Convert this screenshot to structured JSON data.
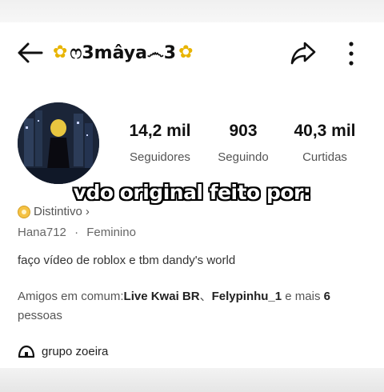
{
  "header": {
    "title": "ෆ3mâya෴3",
    "flower_glyph": "✿",
    "back_icon": "arrow-left-icon",
    "share_icon": "share-icon",
    "more_icon": "more-vertical-icon"
  },
  "stats": [
    {
      "value": "14,2 mil",
      "label": "Seguidores"
    },
    {
      "value": "903",
      "label": "Seguindo"
    },
    {
      "value": "40,3 mil",
      "label": "Curtidas"
    }
  ],
  "overlay_caption": "vdo original feito por:",
  "badge": {
    "label": "Distintivo",
    "chevron": "›"
  },
  "user_meta": {
    "username": "Hana712",
    "separator": "·",
    "gender": "Feminino"
  },
  "bio": "faço vídeo de roblox e tbm dandy's world",
  "mutual": {
    "prefix": "Amigos em comum:",
    "friend1": "Live Kwai BR",
    "sep": "、",
    "friend2": "Felypinhu_1",
    "middle": " e mais ",
    "count": "6",
    "suffix": "pessoas"
  },
  "group": {
    "label": "grupo zoeira"
  },
  "colors": {
    "badge": "#f5c243",
    "flower": "#e8b400",
    "text_dark": "#111111",
    "text_muted": "#555555"
  }
}
